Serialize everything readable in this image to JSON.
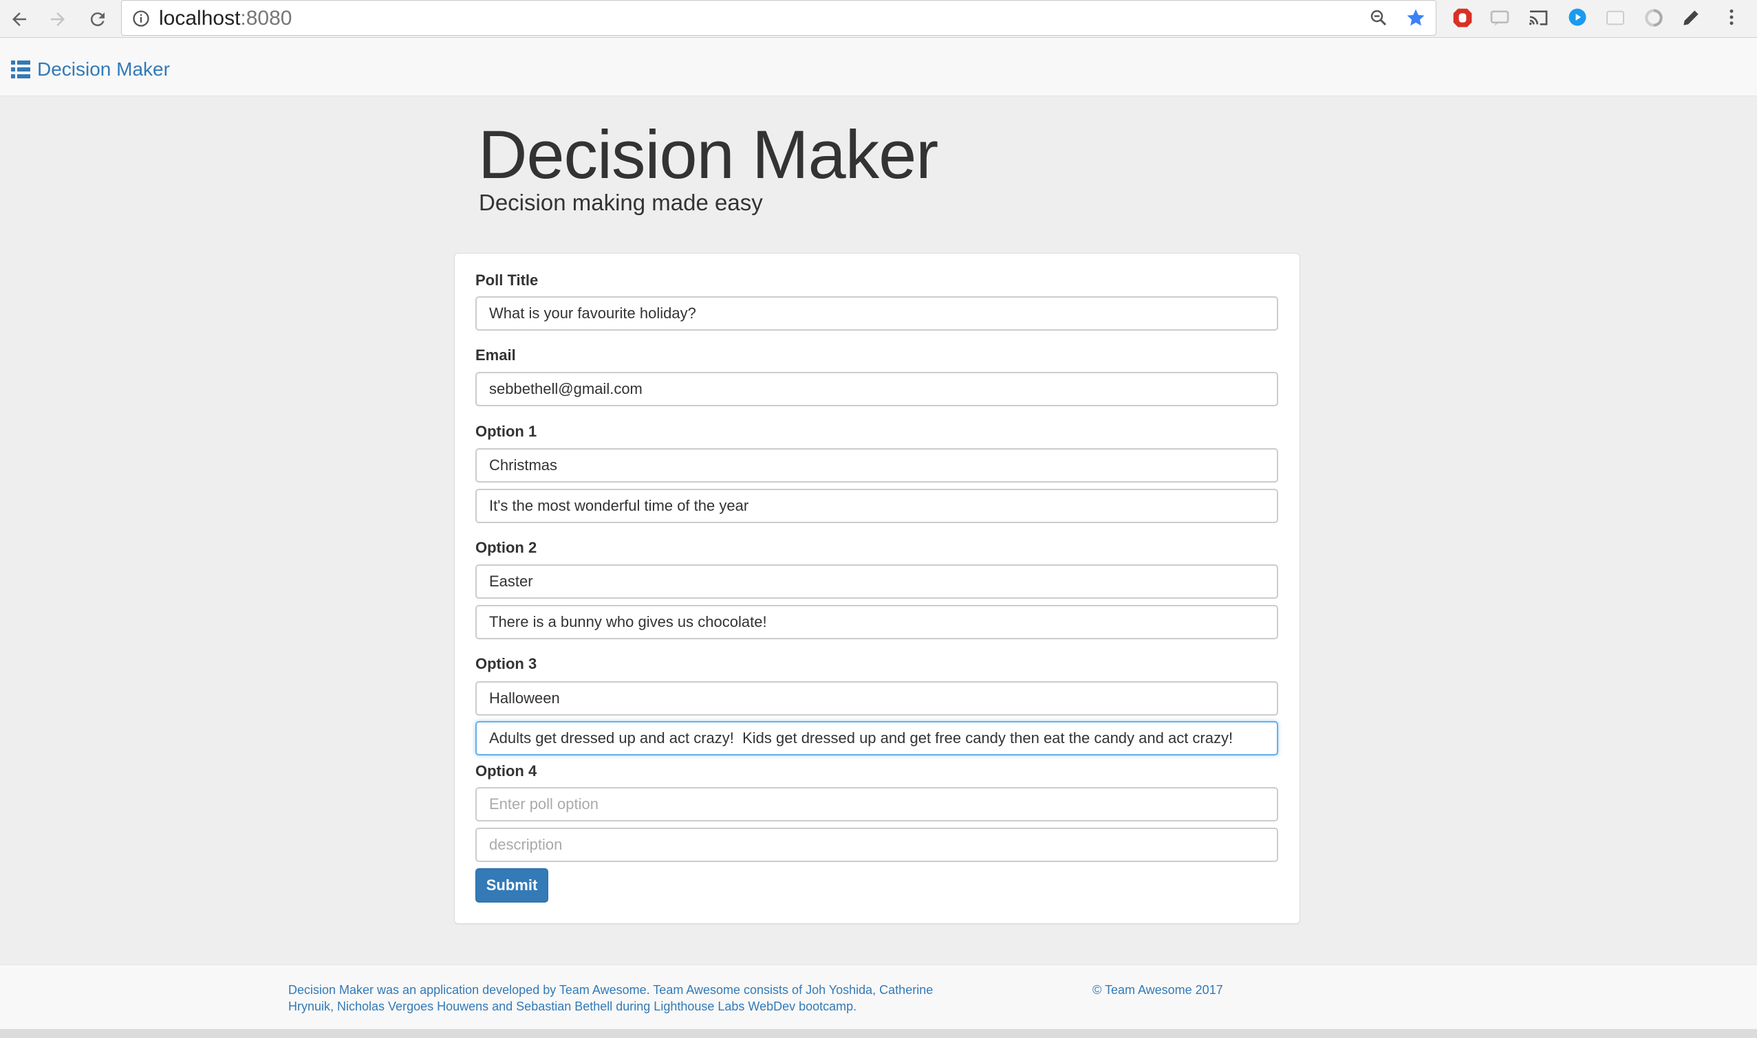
{
  "browser": {
    "url_host": "localhost",
    "url_port": ":8080"
  },
  "navbar": {
    "brand": "Decision Maker"
  },
  "hero": {
    "title": "Decision Maker",
    "subtitle": "Decision making made easy"
  },
  "form": {
    "poll_title_label": "Poll Title",
    "poll_title_value": "What is your favourite holiday?",
    "email_label": "Email",
    "email_value": "sebbethell@gmail.com",
    "options": [
      {
        "label": "Option 1",
        "title": "Christmas",
        "description": "It's the most wonderful time of the year"
      },
      {
        "label": "Option 2",
        "title": "Easter",
        "description": "There is a bunny who gives us chocolate!"
      },
      {
        "label": "Option 3",
        "title": "Halloween",
        "description": "Adults get dressed up and act crazy!  Kids get dressed up and get free candy then eat the candy and act crazy!"
      },
      {
        "label": "Option 4",
        "title": "",
        "description": ""
      }
    ],
    "option_placeholder": "Enter poll option",
    "description_placeholder": "description",
    "submit_label": "Submit"
  },
  "footer": {
    "about": "Decision Maker was an application developed by Team Awesome. Team Awesome consists of Joh Yoshida, Catherine Hrynuik, Nicholas Vergoes Houwens and Sebastian Bethell during Lighthouse Labs WebDev bootcamp.",
    "copyright": "© Team Awesome 2017"
  },
  "colors": {
    "link": "#337ab7",
    "background": "#eeeeee",
    "focus": "#66afe9"
  },
  "icons": [
    "back-arrow-icon",
    "forward-arrow-icon",
    "reload-icon",
    "info-icon",
    "zoom-icon",
    "bookmark-star-icon",
    "list-icon"
  ]
}
